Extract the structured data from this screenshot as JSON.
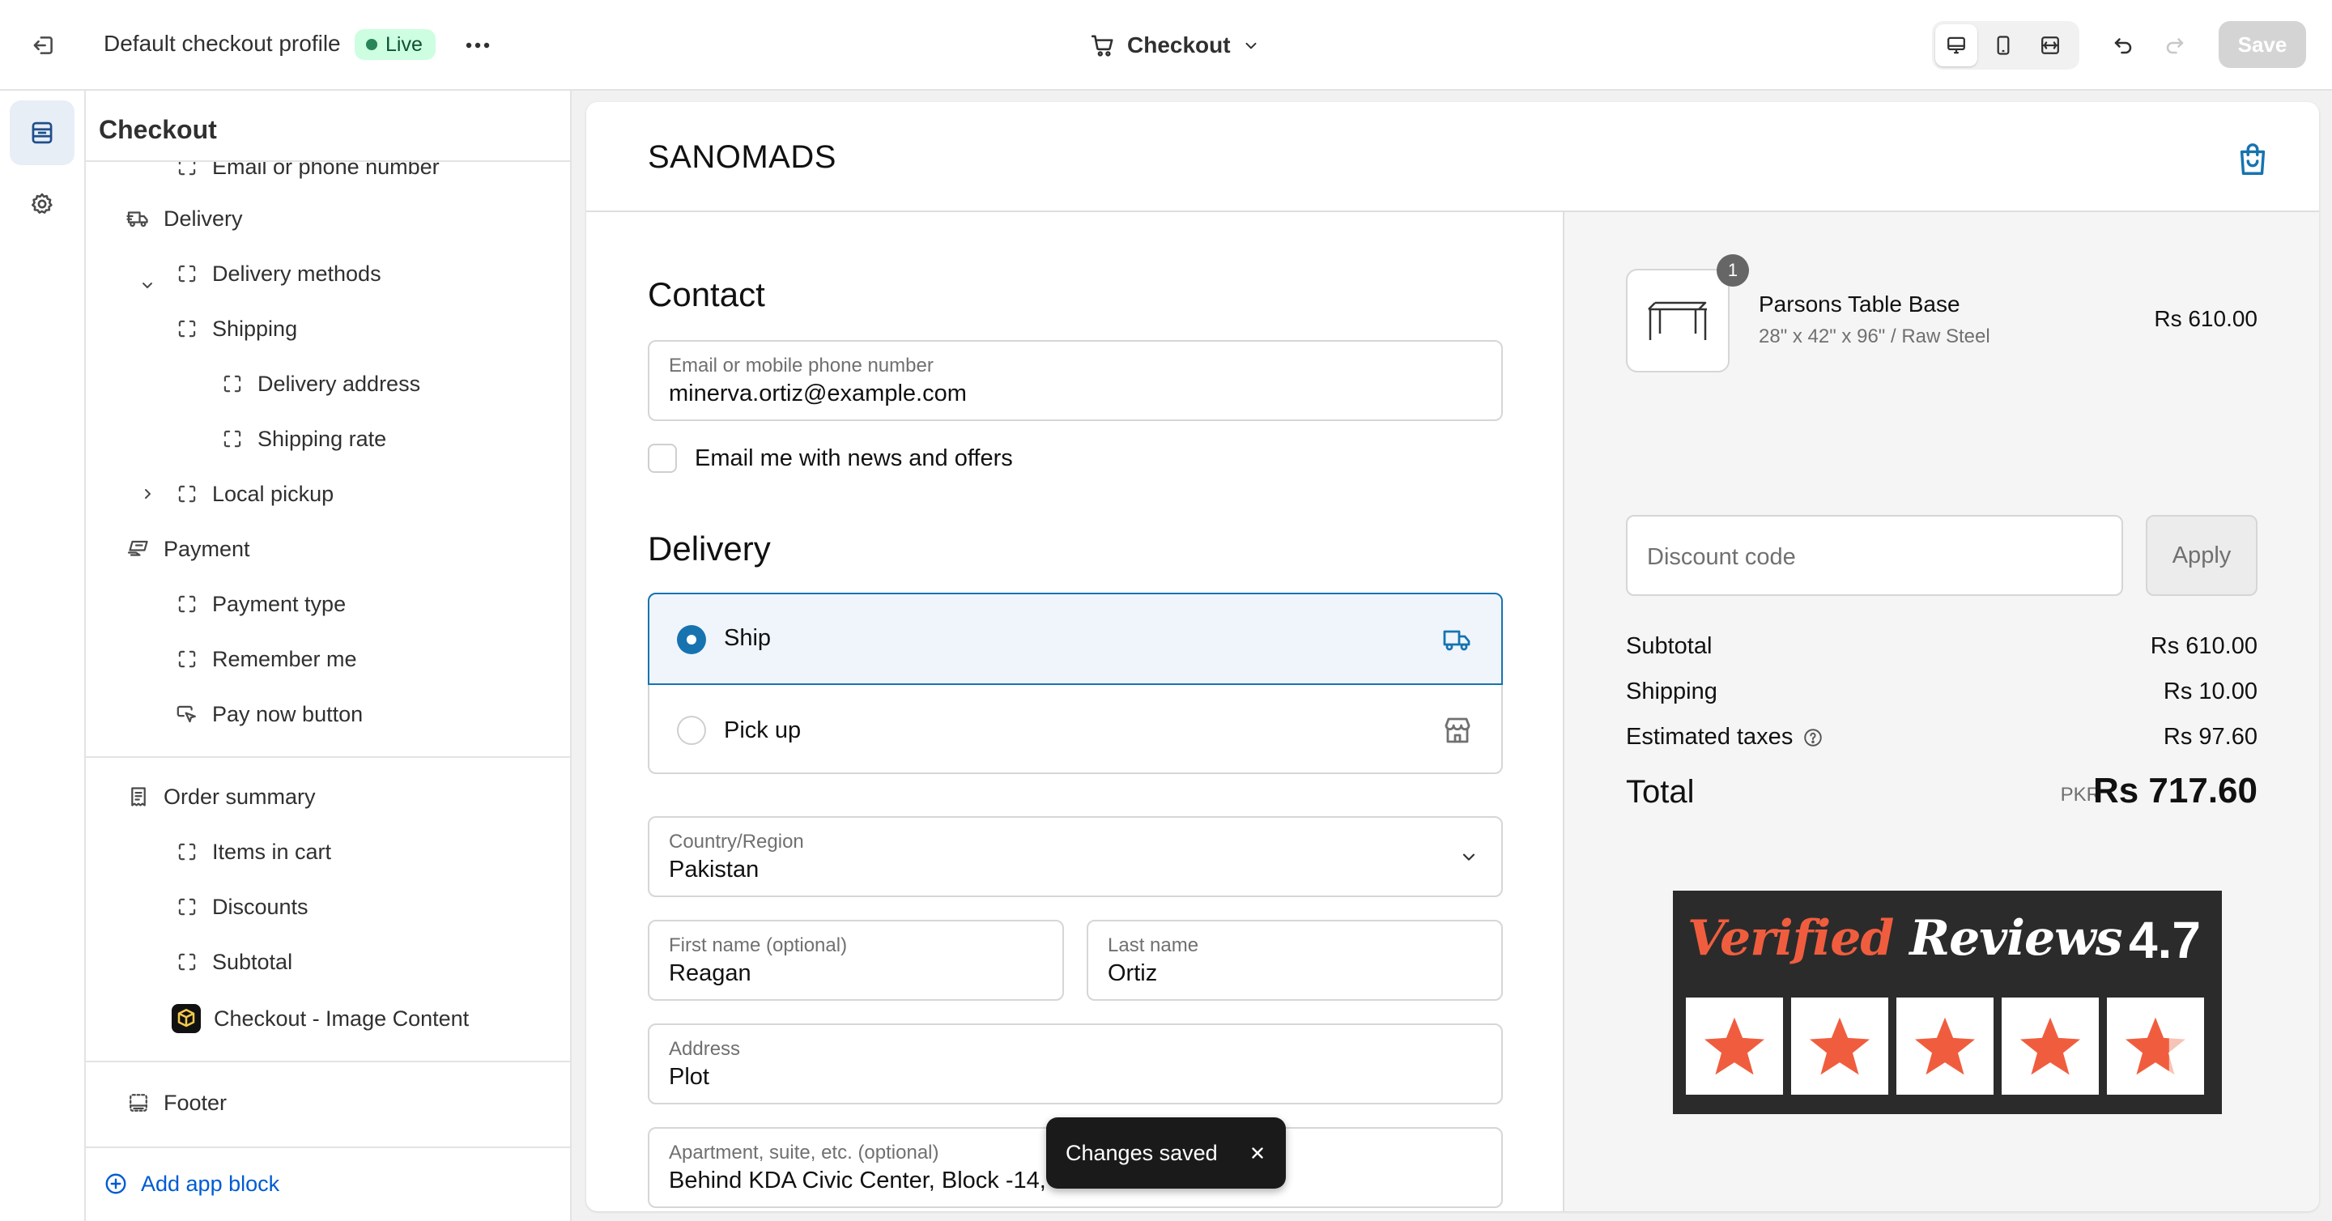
{
  "topbar": {
    "profile_name": "Default checkout profile",
    "status_badge": "Live",
    "page_selector": "Checkout",
    "save_label": "Save"
  },
  "sidebar": {
    "title": "Checkout",
    "items": [
      {
        "label": "Email or phone number",
        "icon": "block-icon"
      },
      {
        "label": "Delivery",
        "icon": "truck-icon"
      },
      {
        "label": "Delivery methods",
        "icon": "block-icon"
      },
      {
        "label": "Shipping",
        "icon": "block-icon",
        "expanded": true
      },
      {
        "label": "Delivery address",
        "icon": "block-icon"
      },
      {
        "label": "Shipping rate",
        "icon": "block-icon"
      },
      {
        "label": "Local pickup",
        "icon": "block-icon",
        "expanded": false
      },
      {
        "label": "Payment",
        "icon": "hand-money-icon"
      },
      {
        "label": "Payment type",
        "icon": "block-icon"
      },
      {
        "label": "Remember me",
        "icon": "block-icon"
      },
      {
        "label": "Pay now button",
        "icon": "cursor-click-icon"
      },
      {
        "label": "Order summary",
        "icon": "receipt-icon"
      },
      {
        "label": "Items in cart",
        "icon": "block-icon"
      },
      {
        "label": "Discounts",
        "icon": "block-icon"
      },
      {
        "label": "Subtotal",
        "icon": "block-icon"
      },
      {
        "label": "Checkout - Image Content",
        "icon": "app-icon"
      },
      {
        "label": "Footer",
        "icon": "footer-icon"
      }
    ],
    "add_app_block": "Add app block"
  },
  "preview": {
    "brand": "SANOMADS",
    "contact": {
      "heading": "Contact",
      "email_label": "Email or mobile phone number",
      "email_value": "minerva.ortiz@example.com",
      "newsletter_label": "Email me with news and offers"
    },
    "delivery": {
      "heading": "Delivery",
      "options": [
        {
          "label": "Ship",
          "selected": true,
          "icon": "truck-icon"
        },
        {
          "label": "Pick up",
          "selected": false,
          "icon": "store-icon"
        }
      ],
      "country_label": "Country/Region",
      "country_value": "Pakistan",
      "first_name_label": "First name (optional)",
      "first_name_value": "Reagan",
      "last_name_label": "Last name",
      "last_name_value": "Ortiz",
      "address_label": "Address",
      "address_value": "Plot",
      "apartment_label": "Apartment, suite, etc. (optional)",
      "apartment_value": "Behind KDA Civic Center, Block -14,"
    },
    "summary": {
      "product_name": "Parsons Table Base",
      "product_variant": "28\" x 42\" x 96\" / Raw Steel",
      "product_qty": "1",
      "product_price": "Rs 610.00",
      "discount_placeholder": "Discount code",
      "apply_label": "Apply",
      "subtotal_label": "Subtotal",
      "subtotal_value": "Rs 610.00",
      "shipping_label": "Shipping",
      "shipping_value": "Rs 10.00",
      "taxes_label": "Estimated taxes",
      "taxes_value": "Rs 97.60",
      "total_label": "Total",
      "total_currency": "PKR",
      "total_value": "Rs 717.60"
    },
    "reviews_banner": {
      "word1": "Verified",
      "word2": "Reviews",
      "score": "4.7",
      "rating": 4.7,
      "max": 5
    }
  },
  "toast": {
    "message": "Changes saved"
  },
  "colors": {
    "accent_blue": "#1773b0",
    "live_bg": "#cdfee1",
    "live_dot": "#29845a",
    "link_blue": "#005bd3",
    "star_orange": "#f05d3e"
  }
}
